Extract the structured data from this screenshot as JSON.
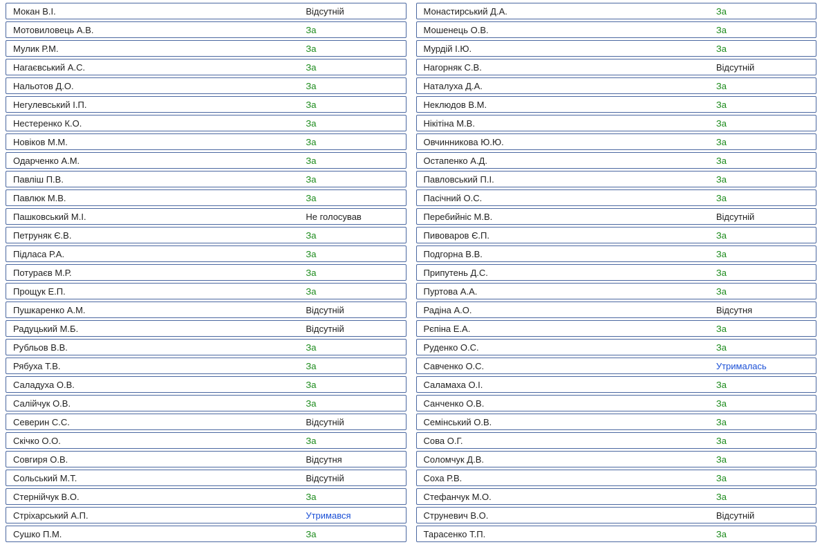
{
  "voteClasses": {
    "За": "vote-for",
    "Відсутній": "vote-absent",
    "Відсутня": "vote-absent",
    "Не голосував": "vote-novote",
    "Утримався": "vote-abstain",
    "Утрималась": "vote-abstain"
  },
  "left": [
    {
      "name": "Мокан В.І.",
      "vote": "Відсутній"
    },
    {
      "name": "Мотовиловець А.В.",
      "vote": "За"
    },
    {
      "name": "Мулик Р.М.",
      "vote": "За"
    },
    {
      "name": "Нагаєвський А.С.",
      "vote": "За"
    },
    {
      "name": "Нальотов Д.О.",
      "vote": "За"
    },
    {
      "name": "Негулевський І.П.",
      "vote": "За"
    },
    {
      "name": "Нестеренко К.О.",
      "vote": "За"
    },
    {
      "name": "Новіков М.М.",
      "vote": "За"
    },
    {
      "name": "Одарченко А.М.",
      "vote": "За"
    },
    {
      "name": "Павліш П.В.",
      "vote": "За"
    },
    {
      "name": "Павлюк М.В.",
      "vote": "За"
    },
    {
      "name": "Пашковський М.І.",
      "vote": "Не голосував"
    },
    {
      "name": "Петруняк Є.В.",
      "vote": "За"
    },
    {
      "name": "Підласа Р.А.",
      "vote": "За"
    },
    {
      "name": "Потураєв М.Р.",
      "vote": "За"
    },
    {
      "name": "Прощук Е.П.",
      "vote": "За"
    },
    {
      "name": "Пушкаренко А.М.",
      "vote": "Відсутній"
    },
    {
      "name": "Радуцький М.Б.",
      "vote": "Відсутній"
    },
    {
      "name": "Рубльов В.В.",
      "vote": "За"
    },
    {
      "name": "Рябуха Т.В.",
      "vote": "За"
    },
    {
      "name": "Саладуха О.В.",
      "vote": "За"
    },
    {
      "name": "Салійчук О.В.",
      "vote": "За"
    },
    {
      "name": "Северин С.С.",
      "vote": "Відсутній"
    },
    {
      "name": "Скічко О.О.",
      "vote": "За"
    },
    {
      "name": "Совгиря О.В.",
      "vote": "Відсутня"
    },
    {
      "name": "Сольський М.Т.",
      "vote": "Відсутній"
    },
    {
      "name": "Стернійчук В.О.",
      "vote": "За"
    },
    {
      "name": "Стріхарський А.П.",
      "vote": "Утримався"
    },
    {
      "name": "Сушко П.М.",
      "vote": "За"
    }
  ],
  "right": [
    {
      "name": "Монастирський Д.А.",
      "vote": "За"
    },
    {
      "name": "Мошенець О.В.",
      "vote": "За"
    },
    {
      "name": "Мурдій І.Ю.",
      "vote": "За"
    },
    {
      "name": "Нагорняк С.В.",
      "vote": "Відсутній"
    },
    {
      "name": "Наталуха Д.А.",
      "vote": "За"
    },
    {
      "name": "Неклюдов В.М.",
      "vote": "За"
    },
    {
      "name": "Нікітіна М.В.",
      "vote": "За"
    },
    {
      "name": "Овчинникова Ю.Ю.",
      "vote": "За"
    },
    {
      "name": "Остапенко А.Д.",
      "vote": "За"
    },
    {
      "name": "Павловський П.І.",
      "vote": "За"
    },
    {
      "name": "Пасічний О.С.",
      "vote": "За"
    },
    {
      "name": "Перебийніс М.В.",
      "vote": "Відсутній"
    },
    {
      "name": "Пивоваров Є.П.",
      "vote": "За"
    },
    {
      "name": "Подгорна В.В.",
      "vote": "За"
    },
    {
      "name": "Припутень Д.С.",
      "vote": "За"
    },
    {
      "name": "Пуртова А.А.",
      "vote": "За"
    },
    {
      "name": "Радіна А.О.",
      "vote": "Відсутня"
    },
    {
      "name": "Рєпіна Е.А.",
      "vote": "За"
    },
    {
      "name": "Руденко О.С.",
      "vote": "За"
    },
    {
      "name": "Савченко О.С.",
      "vote": "Утрималась"
    },
    {
      "name": "Саламаха О.І.",
      "vote": "За"
    },
    {
      "name": "Санченко О.В.",
      "vote": "За"
    },
    {
      "name": "Семінський О.В.",
      "vote": "За"
    },
    {
      "name": "Сова О.Г.",
      "vote": "За"
    },
    {
      "name": "Соломчук Д.В.",
      "vote": "За"
    },
    {
      "name": "Соха Р.В.",
      "vote": "За"
    },
    {
      "name": "Стефанчук М.О.",
      "vote": "За"
    },
    {
      "name": "Струневич В.О.",
      "vote": "Відсутній"
    },
    {
      "name": "Тарасенко Т.П.",
      "vote": "За"
    }
  ]
}
